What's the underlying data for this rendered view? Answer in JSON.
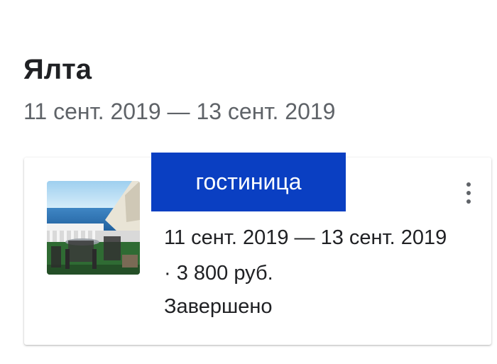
{
  "trip": {
    "title": "Ялта",
    "dates": "11 сент. 2019 — 13 сент. 2019"
  },
  "card": {
    "category": "гостиница",
    "details": "11 сент. 2019 — 13 сент. 2019 · 3 800 руб.",
    "status": "Завершено",
    "menu_icon": "more-vert-icon",
    "category_color": "#0a3fc2"
  }
}
